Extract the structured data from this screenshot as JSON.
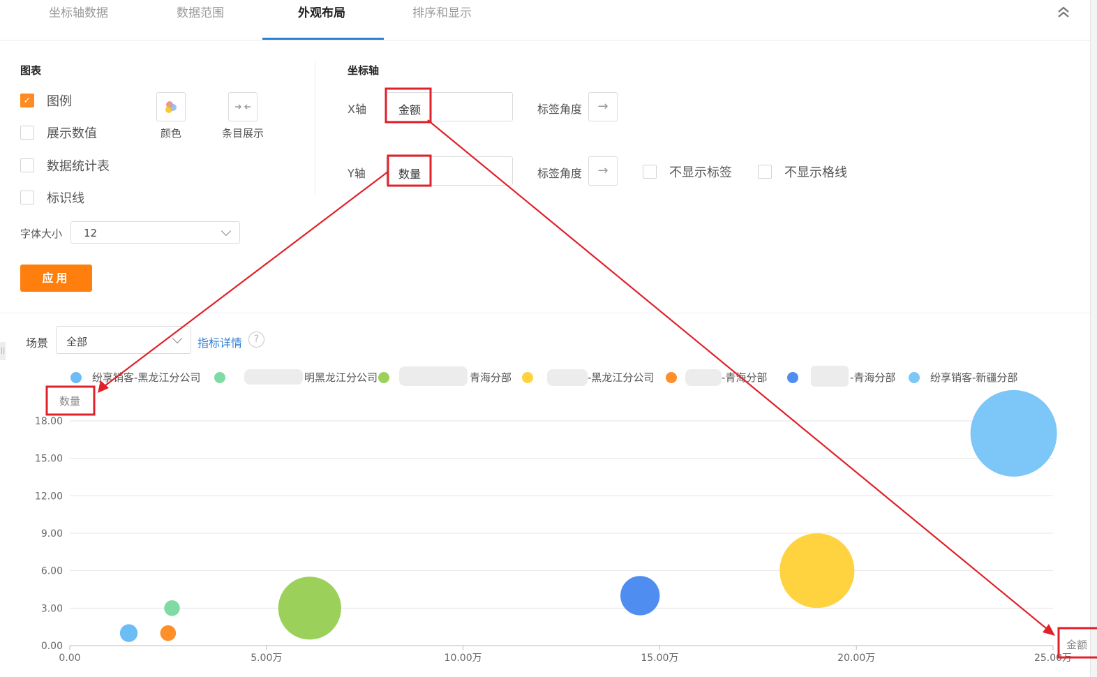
{
  "tabs": [
    {
      "label": "坐标轴数据",
      "active": false
    },
    {
      "label": "数据范围",
      "active": false
    },
    {
      "label": "外观布局",
      "active": true
    },
    {
      "label": "排序和显示",
      "active": false
    }
  ],
  "chart_section": {
    "title": "图表",
    "checkboxes": [
      {
        "label": "图例",
        "checked": true
      },
      {
        "label": "展示数值",
        "checked": false
      },
      {
        "label": "数据统计表",
        "checked": false
      },
      {
        "label": "标识线",
        "checked": false
      }
    ],
    "color_label": "颜色",
    "items_label": "条目展示",
    "font_size_label": "字体大小",
    "font_size_value": "12",
    "apply_label": "应用"
  },
  "axis_section": {
    "title": "坐标轴",
    "x_label": "X轴",
    "x_value": "金额",
    "y_label": "Y轴",
    "y_value": "数量",
    "angle_label": "标签角度",
    "hide_labels": "不显示标签",
    "hide_gridlines": "不显示格线"
  },
  "scene": {
    "label": "场景",
    "value": "全部",
    "details_link": "指标详情",
    "help_glyph": "?"
  },
  "legend": [
    {
      "name": "纷享销客-黑龙江分公司",
      "color": "#6cbcf5"
    },
    {
      "name": "明黑龙江分公司",
      "color": "#7fdba3"
    },
    {
      "name": "青海分部",
      "color": "#9bd15a"
    },
    {
      "name": "-黑龙江分公司",
      "color": "#ffd23f"
    },
    {
      "name": "-青海分部",
      "color": "#ff8f2b"
    },
    {
      "name": "-青海分部",
      "color": "#4f8ef0"
    },
    {
      "name": "纷享销客-新疆分部",
      "color": "#7cc6f8"
    }
  ],
  "colors": {
    "accent": "#ff7f0e",
    "link": "#2f7fd6",
    "annotation": "#e0202a"
  },
  "chart_data": {
    "type": "scatter",
    "title": "",
    "xlabel": "金额",
    "ylabel": "数量",
    "xlim": [
      0,
      25
    ],
    "ylim": [
      0,
      18
    ],
    "x_ticks": [
      "0.00",
      "5.00万",
      "10.00万",
      "15.00万",
      "20.00万",
      "25.00万"
    ],
    "y_ticks": [
      "0.00",
      "3.00",
      "6.00",
      "9.00",
      "12.00",
      "15.00",
      "18.00"
    ],
    "grid": true,
    "legend_position": "top",
    "points": [
      {
        "series": "纷享销客-黑龙江分公司",
        "x": 1.5,
        "y": 1,
        "size": 0.9,
        "color": "#6cbcf5"
      },
      {
        "series": "明黑龙江分公司",
        "x": 2.6,
        "y": 3,
        "size": 0.8,
        "color": "#7fdba3"
      },
      {
        "series": "青海分部",
        "x": 6.1,
        "y": 3,
        "size": 3.2,
        "color": "#9bd15a"
      },
      {
        "series": "-黑龙江分公司",
        "x": 19.0,
        "y": 6,
        "size": 3.8,
        "color": "#ffd23f"
      },
      {
        "series": "-青海分部",
        "x": 2.5,
        "y": 1,
        "size": 0.8,
        "color": "#ff8f2b"
      },
      {
        "series": "-青海分部",
        "x": 14.5,
        "y": 4,
        "size": 2.0,
        "color": "#4f8ef0"
      },
      {
        "series": "纷享销客-新疆分部",
        "x": 24.0,
        "y": 17,
        "size": 4.4,
        "color": "#7cc6f8"
      }
    ]
  }
}
